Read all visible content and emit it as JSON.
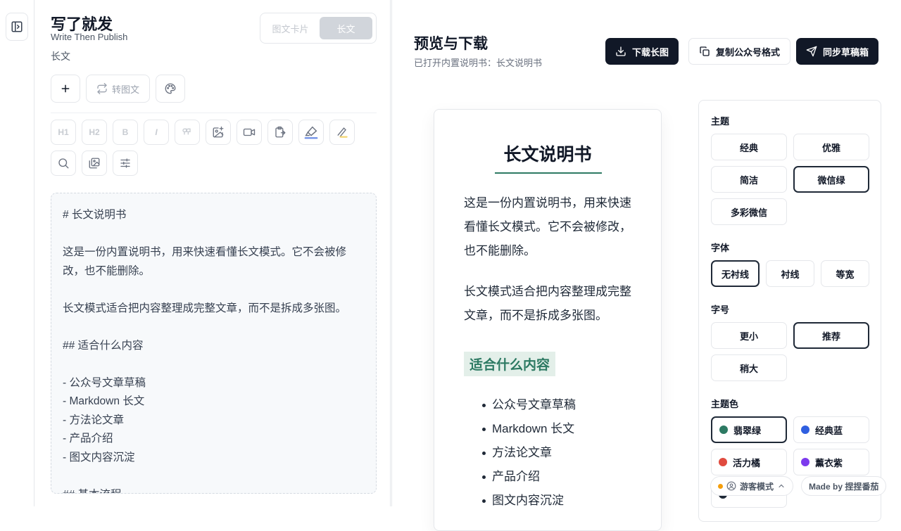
{
  "app": {
    "title": "写了就发",
    "subtitle": "Write Then Publish",
    "mode_label": "长文"
  },
  "mode_switch": {
    "options": [
      "图文卡片",
      "长文"
    ],
    "selected": "长文"
  },
  "toolbar": {
    "convert_label": "转图文"
  },
  "format_tools": {
    "h1": "H1",
    "h2": "H2",
    "bold": "B",
    "italic": "I"
  },
  "editor": {
    "lines": [
      "# 长文说明书",
      "",
      "这是一份内置说明书，用来快速看懂长文模式。它不会被修",
      "改，也不能删除。",
      "",
      "长文模式适合把内容整理成完整文章，而不是拆成多张图。",
      "",
      "## 适合什么内容",
      "",
      "- 公众号文章草稿",
      "- Markdown 长文",
      "- 方法论文章",
      "- 产品介绍",
      "- 图文内容沉淀",
      "",
      "## 基本流程"
    ]
  },
  "preview": {
    "title": "预览与下载",
    "subtitle": "已打开内置说明书：长文说明书",
    "actions": {
      "download": "下载长图",
      "copy": "复制公众号格式",
      "sync": "同步草稿箱"
    },
    "card": {
      "h1": "长文说明书",
      "p1": "这是一份内置说明书，用来快速看懂长文模式。它不会被修改，也不能删除。",
      "p2": "长文模式适合把内容整理成完整文章，而不是拆成多张图。",
      "h2": "适合什么内容",
      "list": [
        "公众号文章草稿",
        "Markdown 长文",
        "方法论文章",
        "产品介绍",
        "图文内容沉淀"
      ]
    }
  },
  "settings": {
    "theme": {
      "label": "主题",
      "options": [
        "经典",
        "优雅",
        "简洁",
        "微信绿",
        "多彩微信"
      ],
      "selected": "微信绿"
    },
    "font": {
      "label": "字体",
      "options": [
        "无衬线",
        "衬线",
        "等宽"
      ],
      "selected": "无衬线"
    },
    "size": {
      "label": "字号",
      "options": [
        "更小",
        "推荐",
        "稍大"
      ],
      "selected": "推荐"
    },
    "color": {
      "label": "主题色",
      "options": [
        {
          "name": "翡翠绿",
          "color": "#2d7a63"
        },
        {
          "name": "经典蓝",
          "color": "#2f5fe0"
        },
        {
          "name": "活力橘",
          "color": "#e04b3f"
        },
        {
          "name": "薰衣紫",
          "color": "#7c3aed"
        }
      ],
      "selected": "翡翠绿"
    }
  },
  "footer": {
    "guest_mode": "游客模式",
    "made_by": "Made by 捏捏番茄",
    "status_color": "#f59e0b"
  }
}
